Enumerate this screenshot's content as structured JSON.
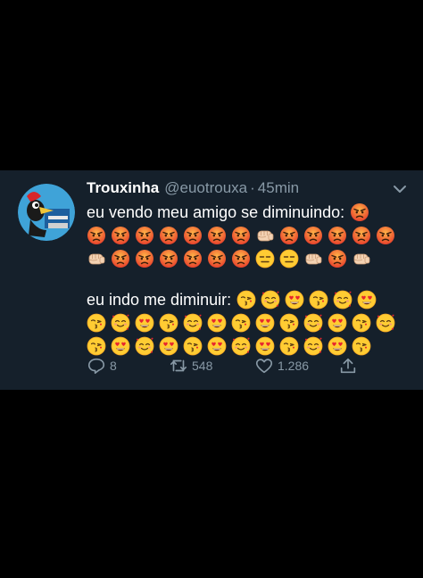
{
  "tweet": {
    "display_name": "Trouxinha",
    "handle": "@euotrouxa",
    "separator": "·",
    "time": "45min",
    "line1_text": "eu vendo meu amigo se diminuindo:",
    "line4_text": "eu indo me diminuir:",
    "emoji_lines": {
      "line1": [
        "angry"
      ],
      "line2": [
        "angry",
        "angry",
        "angry",
        "angry",
        "angry",
        "angry",
        "angry",
        "fist",
        "angry",
        "angry",
        "angry",
        "angry",
        "angry"
      ],
      "line3": [
        "fist",
        "angry",
        "angry",
        "angry",
        "angry",
        "angry",
        "angry",
        "expressionless",
        "expressionless",
        "fist",
        "angry",
        "fist"
      ],
      "line4": [
        "kiss",
        "hearts",
        "heart-eyes",
        "kiss",
        "hearts",
        "heart-eyes"
      ],
      "line5": [
        "kiss",
        "hearts",
        "heart-eyes",
        "kiss",
        "hearts",
        "heart-eyes",
        "kiss",
        "heart-eyes",
        "kiss",
        "hearts",
        "heart-eyes",
        "kiss",
        "hearts"
      ],
      "line6": [
        "kiss",
        "heart-eyes",
        "hearts",
        "heart-eyes",
        "kiss",
        "heart-eyes",
        "hearts",
        "heart-eyes",
        "kiss",
        "hearts",
        "heart-eyes",
        "kiss"
      ]
    },
    "actions": {
      "replies": "8",
      "retweets": "548",
      "likes": "1.286"
    },
    "icons": {
      "reply": "reply-icon",
      "retweet": "retweet-icon",
      "like": "heart-icon",
      "share": "share-icon",
      "more": "chevron-down-icon"
    },
    "colors": {
      "background": "#15202b",
      "text": "#ffffff",
      "muted": "#8899a6"
    }
  }
}
